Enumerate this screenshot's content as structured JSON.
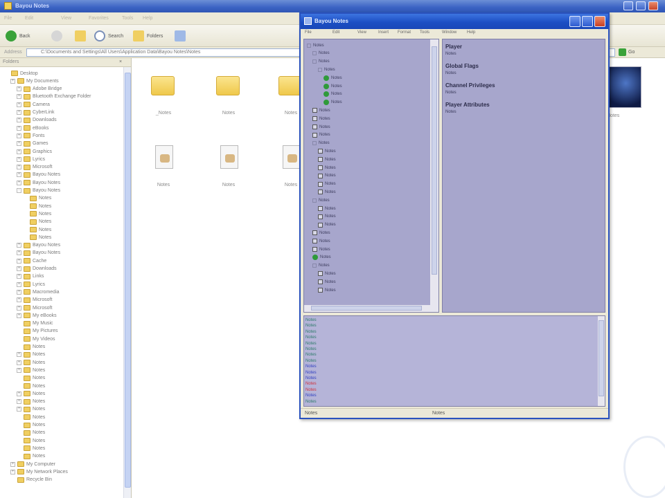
{
  "explorer": {
    "title": "Bayou Notes",
    "menu": [
      "File",
      "Edit",
      "View",
      "Favorites",
      "Tools",
      "Help"
    ],
    "toolbar": {
      "back": "Back",
      "search": "Search",
      "folders": "Folders"
    },
    "address": {
      "label": "Address",
      "path": "C:\\Documents and Settings\\All Users\\Application Data\\Bayou Notes\\Notes",
      "go": "Go"
    },
    "folders_header": "Folders",
    "tree": [
      {
        "label": "Desktop",
        "indent": 0,
        "sign": ""
      },
      {
        "label": "My Documents",
        "indent": 1,
        "sign": "+"
      },
      {
        "label": "Adobe Bridge",
        "indent": 2,
        "sign": "+"
      },
      {
        "label": "Bluetooth Exchange Folder",
        "indent": 2,
        "sign": "+"
      },
      {
        "label": "Camera",
        "indent": 2,
        "sign": "+"
      },
      {
        "label": "CyberLink",
        "indent": 2,
        "sign": "+"
      },
      {
        "label": "Downloads",
        "indent": 2,
        "sign": "+"
      },
      {
        "label": "eBooks",
        "indent": 2,
        "sign": "+"
      },
      {
        "label": "Fonts",
        "indent": 2,
        "sign": "+"
      },
      {
        "label": "Games",
        "indent": 2,
        "sign": "+"
      },
      {
        "label": "Graphics",
        "indent": 2,
        "sign": "+"
      },
      {
        "label": "Lyrics",
        "indent": 2,
        "sign": "+"
      },
      {
        "label": "Microsoft",
        "indent": 2,
        "sign": "+"
      },
      {
        "label": "Bayou Notes",
        "indent": 2,
        "sign": "+"
      },
      {
        "label": "Bayou Notes",
        "indent": 2,
        "sign": "+"
      },
      {
        "label": "Bayou Notes",
        "indent": 2,
        "sign": "-"
      },
      {
        "label": "Notes",
        "indent": 3,
        "sign": ""
      },
      {
        "label": "Notes",
        "indent": 3,
        "sign": ""
      },
      {
        "label": "Notes",
        "indent": 3,
        "sign": ""
      },
      {
        "label": "Notes",
        "indent": 3,
        "sign": ""
      },
      {
        "label": "Notes",
        "indent": 3,
        "sign": ""
      },
      {
        "label": "Notes",
        "indent": 3,
        "sign": ""
      },
      {
        "label": "Bayou Notes",
        "indent": 2,
        "sign": "+"
      },
      {
        "label": "Bayou Notes",
        "indent": 2,
        "sign": "+"
      },
      {
        "label": "Cache",
        "indent": 2,
        "sign": "+"
      },
      {
        "label": "Downloads",
        "indent": 2,
        "sign": "+"
      },
      {
        "label": "Links",
        "indent": 2,
        "sign": "+"
      },
      {
        "label": "Lyrics",
        "indent": 2,
        "sign": "+"
      },
      {
        "label": "Macromedia",
        "indent": 2,
        "sign": "+"
      },
      {
        "label": "Microsoft",
        "indent": 2,
        "sign": "+"
      },
      {
        "label": "Microsoft",
        "indent": 2,
        "sign": "+"
      },
      {
        "label": "My eBooks",
        "indent": 2,
        "sign": "+"
      },
      {
        "label": "My Music",
        "indent": 2,
        "sign": ""
      },
      {
        "label": "My Pictures",
        "indent": 2,
        "sign": ""
      },
      {
        "label": "My Videos",
        "indent": 2,
        "sign": ""
      },
      {
        "label": "Notes",
        "indent": 2,
        "sign": ""
      },
      {
        "label": "Notes",
        "indent": 2,
        "sign": "+"
      },
      {
        "label": "Notes",
        "indent": 2,
        "sign": "+"
      },
      {
        "label": "Notes",
        "indent": 2,
        "sign": "+"
      },
      {
        "label": "Notes",
        "indent": 2,
        "sign": ""
      },
      {
        "label": "Notes",
        "indent": 2,
        "sign": ""
      },
      {
        "label": "Notes",
        "indent": 2,
        "sign": "+"
      },
      {
        "label": "Notes",
        "indent": 2,
        "sign": "+"
      },
      {
        "label": "Notes",
        "indent": 2,
        "sign": "+"
      },
      {
        "label": "Notes",
        "indent": 2,
        "sign": ""
      },
      {
        "label": "Notes",
        "indent": 2,
        "sign": ""
      },
      {
        "label": "Notes",
        "indent": 2,
        "sign": ""
      },
      {
        "label": "Notes",
        "indent": 2,
        "sign": ""
      },
      {
        "label": "Notes",
        "indent": 2,
        "sign": ""
      },
      {
        "label": "Notes",
        "indent": 2,
        "sign": ""
      },
      {
        "label": "My Computer",
        "indent": 1,
        "sign": "+"
      },
      {
        "label": "My Network Places",
        "indent": 1,
        "sign": "+"
      },
      {
        "label": "Recycle Bin",
        "indent": 1,
        "sign": ""
      }
    ],
    "files": [
      {
        "name": "_Notes",
        "kind": "folder"
      },
      {
        "name": "Notes",
        "kind": "folder"
      },
      {
        "name": "Notes",
        "kind": "folder"
      },
      {
        "name": "Notes",
        "kind": "doc"
      },
      {
        "name": "Notes",
        "kind": "doc"
      },
      {
        "name": "Notes",
        "kind": "doc"
      }
    ],
    "thumbnail_caption": "Notes"
  },
  "dialog": {
    "title": "Bayou Notes",
    "menu": [
      "File",
      "Edit",
      "View",
      "Insert",
      "Format",
      "Tools",
      "Window",
      "Help"
    ],
    "tree": [
      {
        "label": "Notes",
        "indent": 0,
        "icon": "pm"
      },
      {
        "label": "Notes",
        "indent": 1,
        "icon": "pm"
      },
      {
        "label": "Notes",
        "indent": 1,
        "icon": "pm"
      },
      {
        "label": "Notes",
        "indent": 2,
        "icon": "pm"
      },
      {
        "label": "Notes",
        "indent": 3,
        "icon": "ok"
      },
      {
        "label": "Notes",
        "indent": 3,
        "icon": "ok"
      },
      {
        "label": "Notes",
        "indent": 3,
        "icon": "ok"
      },
      {
        "label": "Notes",
        "indent": 3,
        "icon": "ok"
      },
      {
        "label": "Notes",
        "indent": 1,
        "icon": "ck"
      },
      {
        "label": "Notes",
        "indent": 1,
        "icon": "ck"
      },
      {
        "label": "Notes",
        "indent": 1,
        "icon": "ck"
      },
      {
        "label": "Notes",
        "indent": 1,
        "icon": "ck"
      },
      {
        "label": "Notes",
        "indent": 1,
        "icon": "pm"
      },
      {
        "label": "Notes",
        "indent": 2,
        "icon": "ck"
      },
      {
        "label": "Notes",
        "indent": 2,
        "icon": "ck"
      },
      {
        "label": "Notes",
        "indent": 2,
        "icon": "ck"
      },
      {
        "label": "Notes",
        "indent": 2,
        "icon": "ck"
      },
      {
        "label": "Notes",
        "indent": 2,
        "icon": "ck"
      },
      {
        "label": "Notes",
        "indent": 2,
        "icon": "ck"
      },
      {
        "label": "Notes",
        "indent": 1,
        "icon": "pm"
      },
      {
        "label": "Notes",
        "indent": 2,
        "icon": "ck"
      },
      {
        "label": "Notes",
        "indent": 2,
        "icon": "ck"
      },
      {
        "label": "Notes",
        "indent": 2,
        "icon": "ck"
      },
      {
        "label": "Notes",
        "indent": 1,
        "icon": "ck"
      },
      {
        "label": "Notes",
        "indent": 1,
        "icon": "ck"
      },
      {
        "label": "Notes",
        "indent": 1,
        "icon": "ck"
      },
      {
        "label": "Notes",
        "indent": 1,
        "icon": "ok"
      },
      {
        "label": "Notes",
        "indent": 1,
        "icon": "pm"
      },
      {
        "label": "Notes",
        "indent": 2,
        "icon": "ck"
      },
      {
        "label": "Notes",
        "indent": 2,
        "icon": "ck"
      },
      {
        "label": "Notes",
        "indent": 2,
        "icon": "ck"
      }
    ],
    "properties": [
      {
        "heading": "Player",
        "value": "Notes"
      },
      {
        "heading": "Global Flags",
        "value": "Notes"
      },
      {
        "heading": "Channel Privileges",
        "value": "Notes"
      },
      {
        "heading": "Player Attributes",
        "value": "Notes"
      }
    ],
    "log": [
      {
        "text": "Notes",
        "color": "#2d7a6a"
      },
      {
        "text": "Notes",
        "color": "#2d7a6a"
      },
      {
        "text": "Notes",
        "color": "#2d7a6a"
      },
      {
        "text": "Notes",
        "color": "#2d7a6a"
      },
      {
        "text": "Notes",
        "color": "#2d7a6a"
      },
      {
        "text": "Notes",
        "color": "#2d7a6a"
      },
      {
        "text": "Notes",
        "color": "#2d7a6a"
      },
      {
        "text": "Notes",
        "color": "#2d7a6a"
      },
      {
        "text": "Notes",
        "color": "#2f3fc0"
      },
      {
        "text": "Notes",
        "color": "#2f3fc0"
      },
      {
        "text": "Notes",
        "color": "#2f3fc0"
      },
      {
        "text": "Notes",
        "color": "#d0303a"
      },
      {
        "text": "Notes",
        "color": "#d0303a"
      },
      {
        "text": "Notes",
        "color": "#2f3fc0"
      },
      {
        "text": "Notes",
        "color": "#2d7a6a"
      }
    ],
    "status": {
      "left": "Notes",
      "right": "Notes"
    }
  }
}
